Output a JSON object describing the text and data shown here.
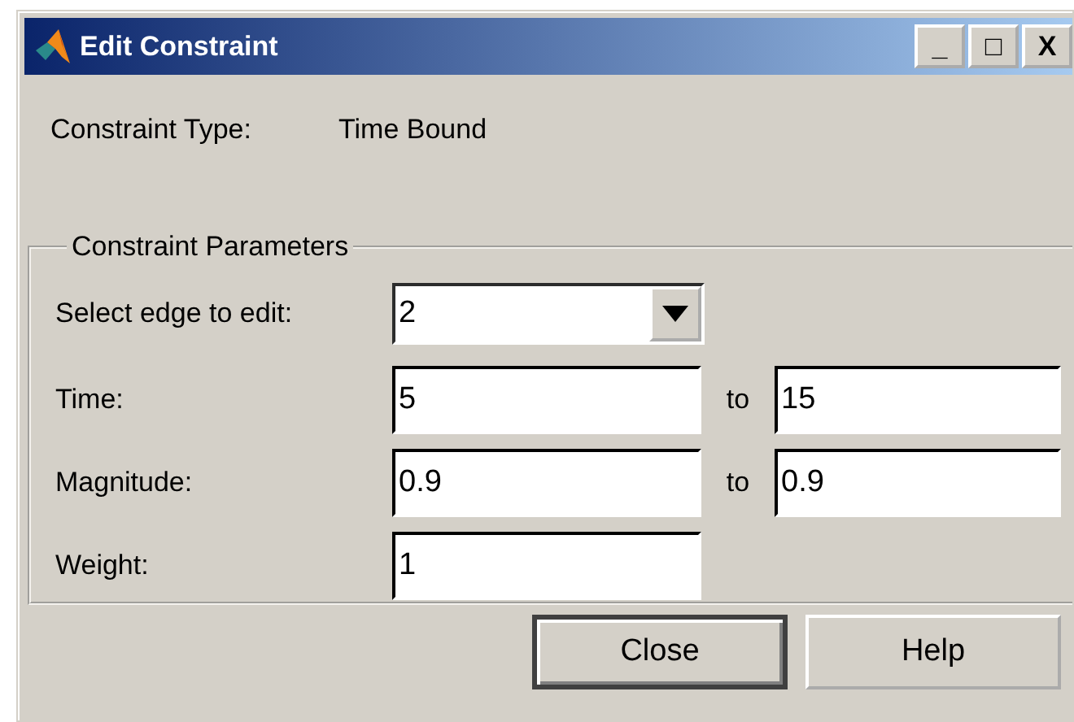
{
  "window": {
    "title": "Edit Constraint",
    "controls": [
      "_",
      "□",
      "X"
    ]
  },
  "constraint_type": {
    "label": "Constraint Type:",
    "value": "Time Bound"
  },
  "group": {
    "title": "Constraint Parameters",
    "rows": [
      {
        "kind": "dropdown",
        "label": "Select edge to edit:",
        "value": "2"
      },
      {
        "kind": "range",
        "label": "Time:",
        "value": "5",
        "separator": "to",
        "value_to": "15"
      },
      {
        "kind": "range",
        "label": "Magnitude:",
        "value": "0.9",
        "separator": "to",
        "value_to": "0.9"
      },
      {
        "kind": "single",
        "label": "Weight:",
        "value": "1"
      }
    ]
  },
  "buttons": [
    {
      "label": "Close",
      "focused": true
    },
    {
      "label": "Help",
      "focused": false
    }
  ]
}
